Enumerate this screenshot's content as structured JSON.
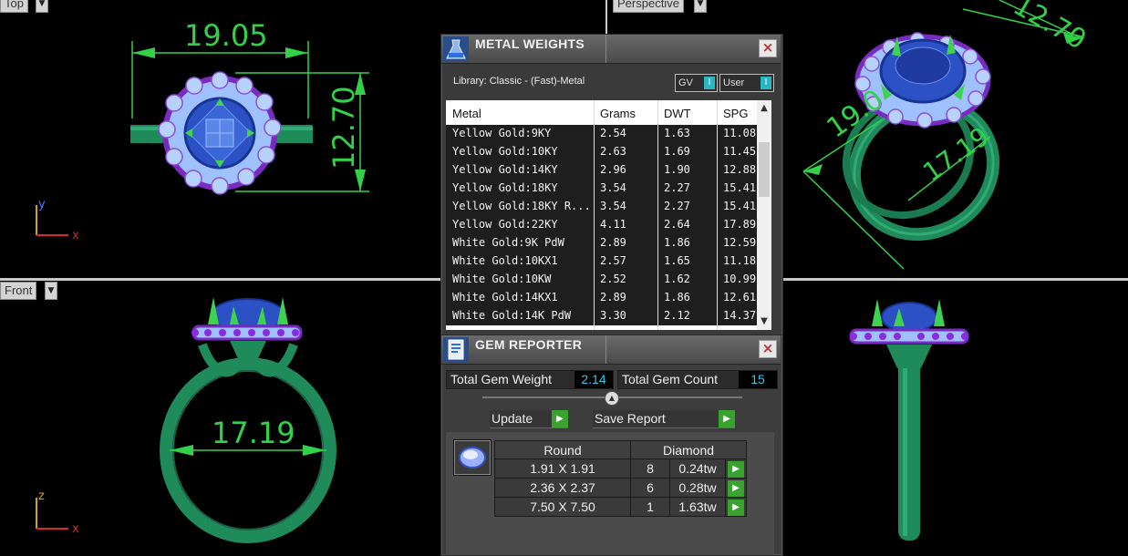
{
  "viewports": {
    "top": {
      "label": "Top",
      "dims": {
        "width": "19.05",
        "height": "12.70"
      },
      "axis": {
        "a": "y",
        "b": "x"
      }
    },
    "perspective": {
      "label": "Perspective",
      "dims": {
        "top_right": "12.70",
        "left": "19.0",
        "front": "17.19"
      }
    },
    "front": {
      "label": "Front",
      "dims": {
        "inner": "17.19"
      },
      "axis": {
        "a": "z",
        "b": "x"
      }
    },
    "right": {
      "label": ""
    }
  },
  "metal_weights": {
    "title": "METAL WEIGHTS",
    "close_glyph": "×",
    "library": "Library: Classic - (Fast)-Metal",
    "toggle_gv": "GV",
    "toggle_user": "User",
    "toggle_knob": "I",
    "columns": {
      "metal": "Metal",
      "grams": "Grams",
      "dwt": "DWT",
      "spg": "SPG"
    },
    "rows": [
      {
        "metal": "Yellow Gold:9KY",
        "grams": "2.54",
        "dwt": "1.63",
        "spg": "11.08"
      },
      {
        "metal": "Yellow Gold:10KY",
        "grams": "2.63",
        "dwt": "1.69",
        "spg": "11.45"
      },
      {
        "metal": "Yellow Gold:14KY",
        "grams": "2.96",
        "dwt": "1.90",
        "spg": "12.88"
      },
      {
        "metal": "Yellow Gold:18KY",
        "grams": "3.54",
        "dwt": "2.27",
        "spg": "15.41"
      },
      {
        "metal": "Yellow Gold:18KY R...",
        "grams": "3.54",
        "dwt": "2.27",
        "spg": "15.41"
      },
      {
        "metal": "Yellow Gold:22KY",
        "grams": "4.11",
        "dwt": "2.64",
        "spg": "17.89"
      },
      {
        "metal": "White Gold:9K PdW",
        "grams": "2.89",
        "dwt": "1.86",
        "spg": "12.59"
      },
      {
        "metal": "White Gold:10KX1",
        "grams": "2.57",
        "dwt": "1.65",
        "spg": "11.18"
      },
      {
        "metal": "White Gold:10KW",
        "grams": "2.52",
        "dwt": "1.62",
        "spg": "10.99"
      },
      {
        "metal": "White Gold:14KX1",
        "grams": "2.89",
        "dwt": "1.86",
        "spg": "12.61"
      },
      {
        "metal": "White Gold:14K PdW",
        "grams": "3.30",
        "dwt": "2.12",
        "spg": "14.37"
      }
    ]
  },
  "gem_reporter": {
    "title": "GEM REPORTER",
    "close_glyph": "×",
    "total_weight_label": "Total Gem Weight",
    "total_weight_value": "2.14",
    "total_count_label": "Total Gem Count",
    "total_count_value": "15",
    "update_label": "Update",
    "save_label": "Save Report",
    "play_glyph": "▶",
    "table": {
      "shape": "Round",
      "material": "Diamond",
      "rows": [
        {
          "size": "1.91 X 1.91",
          "count": "8",
          "weight": "0.24tw"
        },
        {
          "size": "2.36 X 2.37",
          "count": "6",
          "weight": "0.28tw"
        },
        {
          "size": "7.50 X 7.50",
          "count": "1",
          "weight": "1.63tw"
        }
      ]
    }
  },
  "colors": {
    "metal": "#1f8a5a",
    "gem_blue": "#1c3fae",
    "dim_green": "#33d14a",
    "accent_cyan": "#2ec8e6",
    "play_green": "#3aa32f"
  }
}
